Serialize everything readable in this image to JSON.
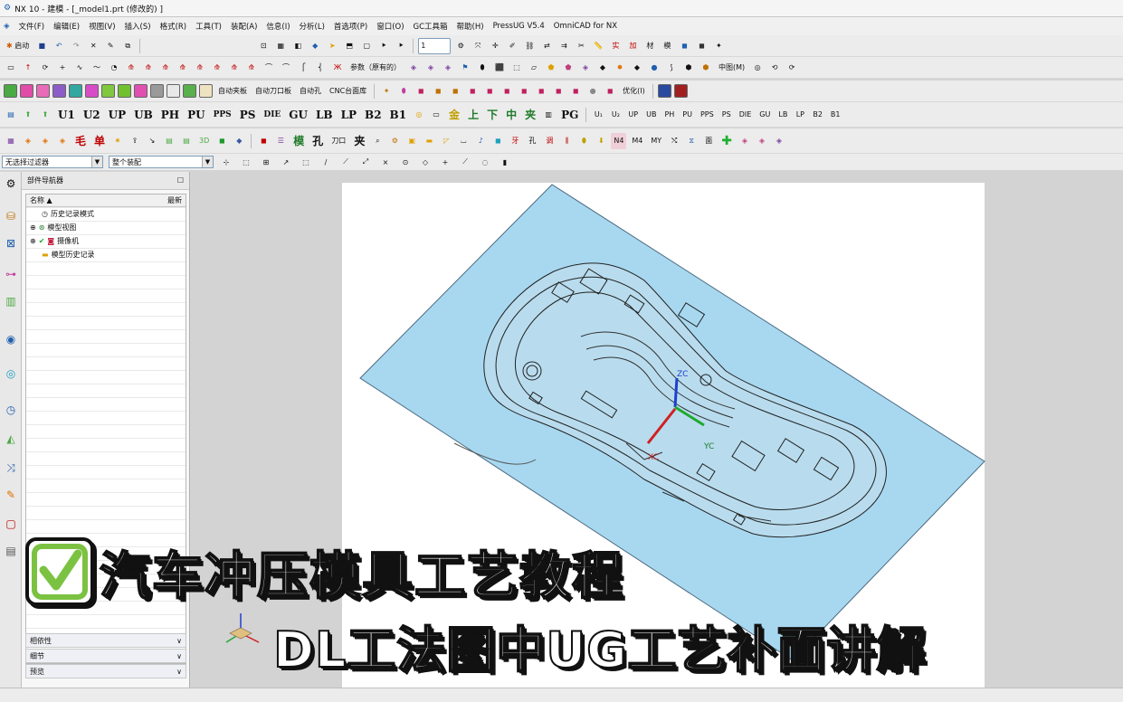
{
  "window": {
    "title": "NX 10 - 建模 - [_model1.prt  (修改的)  ]"
  },
  "menu": [
    "文件(F)",
    "编辑(E)",
    "视图(V)",
    "插入(S)",
    "格式(R)",
    "工具(T)",
    "装配(A)",
    "信息(I)",
    "分析(L)",
    "首选项(P)",
    "窗口(O)",
    "GC工具箱",
    "帮助(H)",
    "PressUG V5.4",
    "OmniCAD for NX"
  ],
  "toolbar1": {
    "start_label": "启动",
    "layer_value": "1"
  },
  "toolbar2": {
    "params_label": "参数（原有的）",
    "middle_label": "中图(M)"
  },
  "toolbar3": {
    "labels": [
      "自动夹板",
      "自动刀口板",
      "自动孔",
      "CNC台面库",
      "优化(I)"
    ]
  },
  "toolbar4": {
    "labels": [
      "U1",
      "U2",
      "UP",
      "UB",
      "PH",
      "PU",
      "PPS",
      "PS",
      "DIE",
      "GU",
      "LB",
      "LP",
      "B2",
      "B1",
      "金",
      "上",
      "下",
      "中",
      "夹",
      "PG"
    ]
  },
  "toolbar5": {
    "labels": [
      "毛",
      "单",
      "孔",
      "夹",
      "N4",
      "M4",
      "MY"
    ]
  },
  "selection": {
    "filter": "无选择过滤器",
    "scope": "整个装配"
  },
  "navigator": {
    "title": "部件导航器",
    "columns": [
      "名称",
      "最新"
    ],
    "items": [
      "历史记录模式",
      "模型视图",
      "摄像机",
      "模型历史记录"
    ],
    "footer": [
      "相依性",
      "细节",
      "预览"
    ]
  },
  "viewport": {
    "axis_labels": [
      "ZC",
      "YC",
      "XC"
    ]
  },
  "overlay": {
    "title": "汽车冲压模具工艺教程",
    "subtitle": "DL工法图中UG工艺补面讲解"
  },
  "colors": {
    "plane": "#a8d8f0",
    "accent_green": "#7cc242",
    "toolbar_bg": "#ececec",
    "viewport_bg": "#d3d3d3"
  }
}
